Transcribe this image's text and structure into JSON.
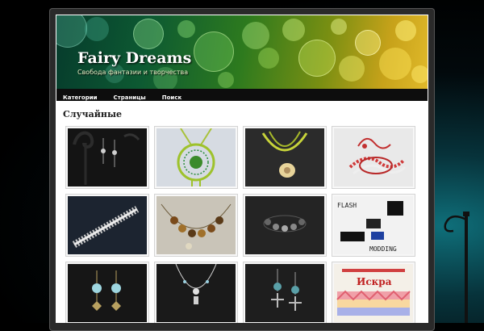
{
  "site": {
    "title": "Fairy Dreams",
    "tagline": "Свобода фантазии и творчества"
  },
  "nav": {
    "items": [
      {
        "label": "Категории"
      },
      {
        "label": "Страницы"
      },
      {
        "label": "Поиск"
      }
    ]
  },
  "section": {
    "title": "Случайные"
  },
  "gallery": {
    "items": [
      {
        "name": "thumb-earrings-dark-stand"
      },
      {
        "name": "thumb-dreamcatcher-pendant-green"
      },
      {
        "name": "thumb-shell-necklace-yellow"
      },
      {
        "name": "thumb-red-white-beaded-lariat"
      },
      {
        "name": "thumb-beaded-bracelet-silver"
      },
      {
        "name": "thumb-brown-bead-bracelet"
      },
      {
        "name": "thumb-dark-bead-bracelet"
      },
      {
        "name": "thumb-flash-modding",
        "text_top": "FLASH",
        "text_bottom": "MODDING"
      },
      {
        "name": "thumb-blue-bead-earrings"
      },
      {
        "name": "thumb-silver-chain-necklace"
      },
      {
        "name": "thumb-dragonfly-earrings-dark"
      },
      {
        "name": "thumb-iskra-pattern-bracelet",
        "text": "Искра"
      }
    ]
  }
}
